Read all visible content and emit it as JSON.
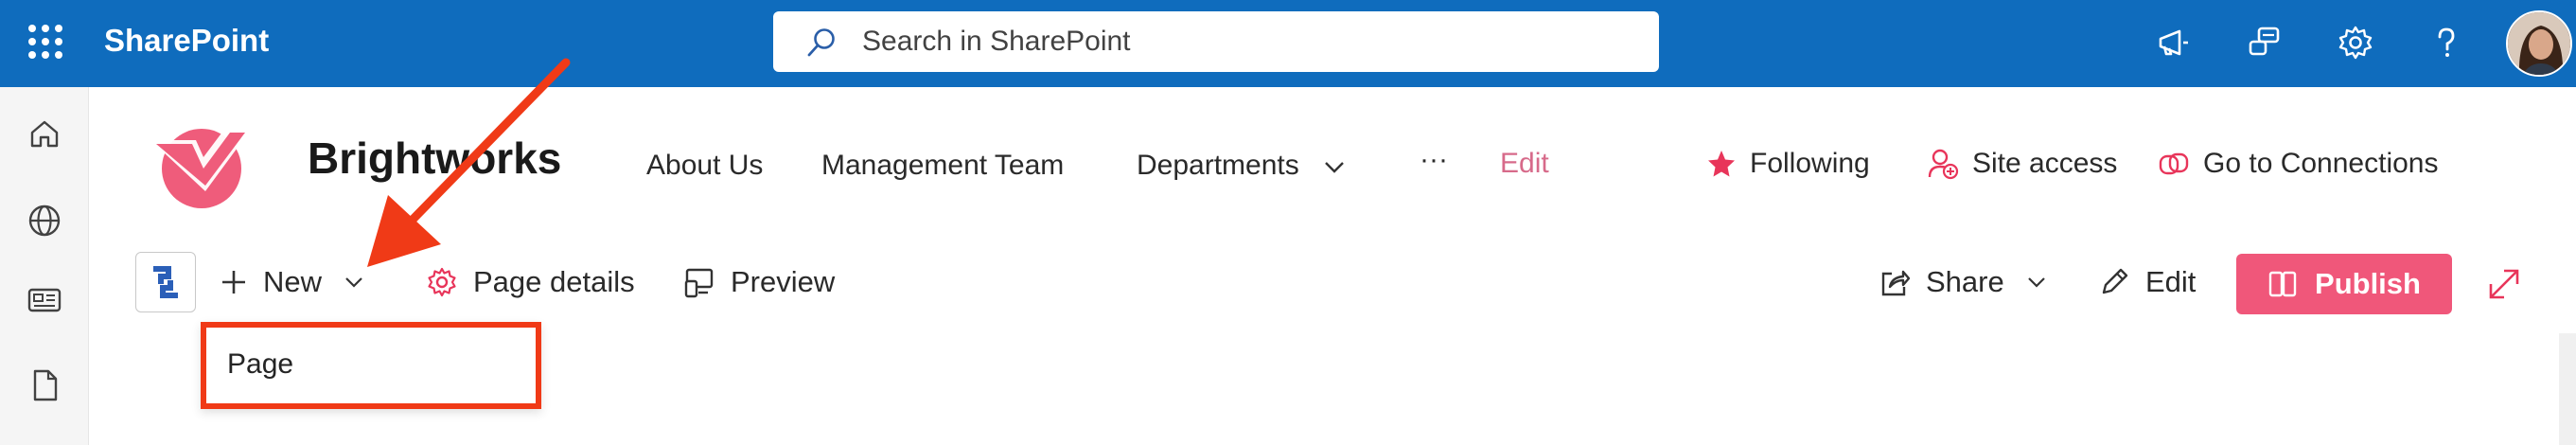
{
  "suite": {
    "app_name": "SharePoint",
    "search_placeholder": "Search in SharePoint",
    "icons": [
      "app-launcher-icon",
      "megaphone-icon",
      "feedback-icon",
      "settings-icon",
      "help-icon",
      "avatar"
    ]
  },
  "rail": {
    "icons": [
      "home-icon",
      "globe-icon",
      "news-icon",
      "file-icon"
    ]
  },
  "site": {
    "title": "Brightworks",
    "nav": [
      "About Us",
      "Management Team",
      "Departments",
      "···",
      "Edit"
    ],
    "actions": {
      "following": "Following",
      "site_access": "Site access",
      "go_to_connections": "Go to Connections"
    }
  },
  "command_bar": {
    "new": "New",
    "page_details": "Page details",
    "preview": "Preview",
    "share": "Share",
    "edit": "Edit",
    "publish": "Publish"
  },
  "new_menu": {
    "items": [
      "Page"
    ]
  },
  "colors": {
    "suite_bar": "#0f6cbd",
    "accent_pink": "#f0577a",
    "callout_red": "#f03a17"
  }
}
